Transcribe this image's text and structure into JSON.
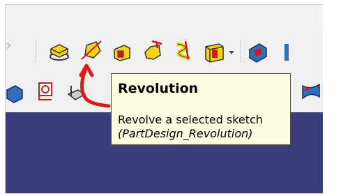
{
  "toolbar": {
    "row1_icons": [
      "pad-icon",
      "revolution-icon",
      "additive-loft-icon",
      "additive-pipe-icon",
      "additive-helix-icon",
      "additive-box-icon",
      "body-icon"
    ],
    "row2_icons": [
      "placement-icon",
      "subtractive-pad-icon",
      "shape-binder-icon",
      "subtractive-loft-icon",
      "fillet-icon"
    ]
  },
  "tooltip": {
    "title": "Revolution",
    "description": "Revolve a selected sketch",
    "command": "(PartDesign_Revolution)"
  },
  "colors": {
    "icon_yellow": "#f5d31a",
    "icon_red": "#d6171c",
    "tooltip_bg": "#fffde0",
    "viewport_bg": "#3b3d7a",
    "annotation_red": "#e01818"
  }
}
